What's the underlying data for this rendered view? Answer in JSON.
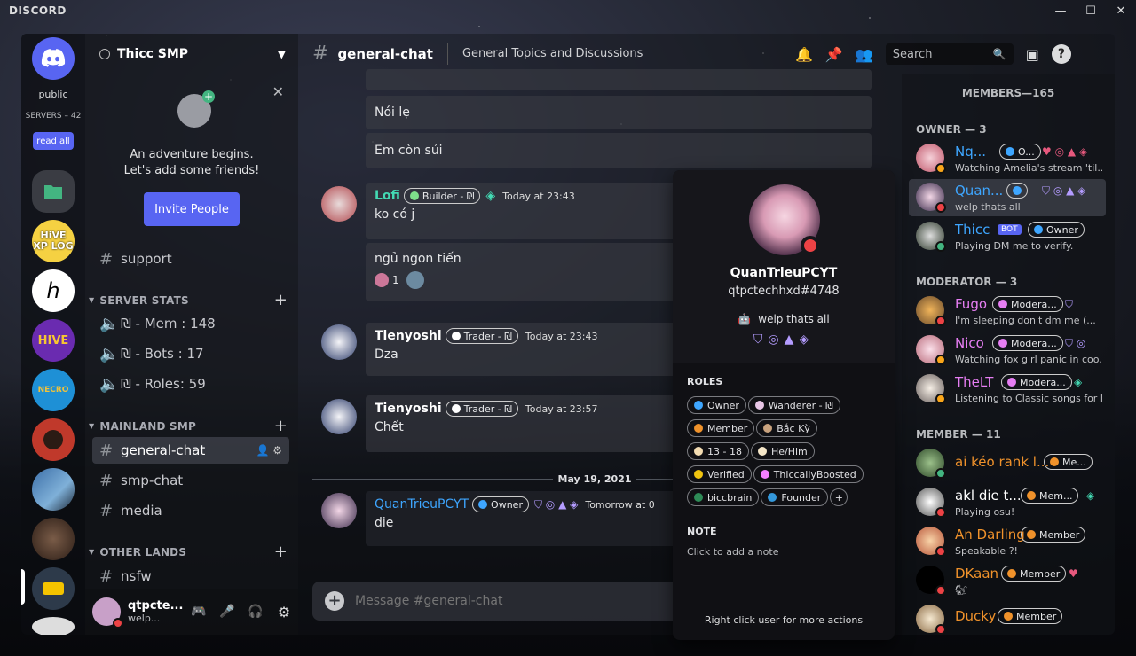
{
  "app": {
    "brand": "DISCORD"
  },
  "window": {
    "minimize": "—",
    "maximize": "☐",
    "close": "✕"
  },
  "guilds": {
    "public_label": "public",
    "servers_label": "SERVERS – 42",
    "read_all": "read all",
    "icons": [
      {
        "name": "home",
        "text": ""
      },
      {
        "name": "folder",
        "text": ""
      },
      {
        "name": "hive-xp-log",
        "text": "HiVE XP LOG"
      },
      {
        "name": "h-server",
        "text": "h"
      },
      {
        "name": "hive",
        "text": "HIVE"
      },
      {
        "name": "necro",
        "text": "NECRO"
      },
      {
        "name": "avatar-server",
        "text": ""
      },
      {
        "name": "city-server",
        "text": ""
      },
      {
        "name": "hair-server",
        "text": ""
      },
      {
        "name": "yellow-server",
        "text": ""
      }
    ]
  },
  "server": {
    "name": "Thicc SMP",
    "invite": {
      "line1": "An adventure begins.",
      "line2": "Let's add some friends!",
      "button": "Invite People"
    },
    "channels": {
      "support": "support",
      "server_stats": "SERVER STATS",
      "mem": "₪ - Mem : 148",
      "bots": "₪ - Bots : 17",
      "roles": "₪ - Roles: 59",
      "mainland": "MAINLAND SMP",
      "general": "general-chat",
      "smp": "smp-chat",
      "media": "media",
      "other": "OTHER LANDS",
      "nsfw": "nsfw"
    }
  },
  "user": {
    "name": "qtpcte...",
    "status": "welp..."
  },
  "chat": {
    "channel": "general-chat",
    "topic": "General Topics and Discussions",
    "search_placeholder": "Search",
    "messages": [
      {
        "text": "Nói lẹ"
      },
      {
        "text": "Em còn sủi"
      },
      {
        "author": "Lofi",
        "role": "Builder - ₪",
        "time": "Today at 23:43",
        "text": "ko có j"
      },
      {
        "text": "ngủ ngon tiến",
        "reaction_count": "1"
      },
      {
        "author": "Tienyoshi",
        "role": "Trader - ₪",
        "time": "Today at 23:43",
        "text": "Dza"
      },
      {
        "author": "Tienyoshi",
        "role": "Trader - ₪",
        "time": "Today at 23:57",
        "text": "Chết"
      },
      {
        "author": "QuanTrieuPCYT",
        "role": "Owner",
        "time": "Tomorrow at 0",
        "text": "die"
      }
    ],
    "divider": "May 19, 2021",
    "composer_placeholder": "Message #general-chat"
  },
  "popout": {
    "username": "QuanTrieuPCYT",
    "tag": "qtpctechhxd#4748",
    "custom_status": "welp thats all",
    "roles_title": "ROLES",
    "roles": [
      {
        "name": "Owner",
        "color": "#3ea6ff"
      },
      {
        "name": "Wanderer - ₪",
        "color": "#e8c6e6"
      },
      {
        "name": "Member",
        "color": "#f0922b"
      },
      {
        "name": "Bắc Kỳ",
        "color": "#c9a27e"
      },
      {
        "name": "13 - 18",
        "color": "#f3dcb2"
      },
      {
        "name": "He/Him",
        "color": "#f5e6c8"
      },
      {
        "name": "Verified",
        "color": "#f1c40f"
      },
      {
        "name": "ThiccallyBoosted",
        "color": "#f47fff"
      },
      {
        "name": "biccbrain",
        "color": "#2e8b57"
      },
      {
        "name": "Founder",
        "color": "#3498db"
      }
    ],
    "add_role": "+",
    "note_title": "NOTE",
    "note_placeholder": "Click to add a note",
    "footer": "Right click user for more actions"
  },
  "members": {
    "header": "MEMBERS—165",
    "groups": [
      {
        "title": "OWNER — 3"
      },
      {
        "title": "MODERATOR — 3"
      },
      {
        "title": "MEMBER — 11"
      }
    ],
    "list": [
      {
        "name": "Nq...",
        "role": "O...",
        "status": "Watching Amelia's stream 'til...",
        "color": "#3ea6ff"
      },
      {
        "name": "Quan...",
        "role": "",
        "status": "welp thats all",
        "color": "#3ea6ff"
      },
      {
        "name": "Thicc",
        "bot": "BOT",
        "role": "Owner",
        "status": "Playing DM me to verify.",
        "color": "#3ea6ff"
      },
      {
        "name": "Fugo",
        "role": "Modera...",
        "status": "I'm sleeping don't dm me (...",
        "color": "#e67ef3"
      },
      {
        "name": "Nico",
        "role": "Modera...",
        "status": "Watching fox girl panic in coo...",
        "color": "#e67ef3"
      },
      {
        "name": "TheLT",
        "role": "Modera...",
        "status": "Listening to Classic songs for l...",
        "color": "#e67ef3"
      },
      {
        "name": "ai kéo rank l...",
        "role": "Me...",
        "status": "",
        "color": "#f0922b"
      },
      {
        "name": "akl die t...",
        "role": "Mem...",
        "status": "Playing osu!",
        "color": "#ffffff"
      },
      {
        "name": "An Darling",
        "role": "Member",
        "status": "Speakable ?!",
        "color": "#f0922b"
      },
      {
        "name": "DKaan",
        "role": "Member",
        "status": "🐿",
        "color": "#f0922b"
      },
      {
        "name": "Ducky",
        "role": "Member",
        "status": "",
        "color": "#f0922b"
      }
    ]
  }
}
